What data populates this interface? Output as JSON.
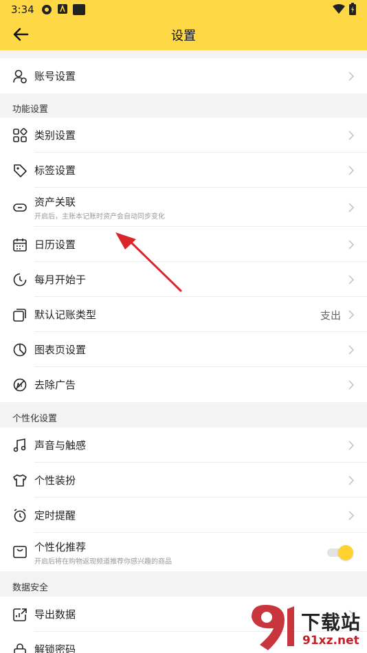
{
  "status": {
    "time": "3:34"
  },
  "header": {
    "title": "设置"
  },
  "account": {
    "label": "账号设置"
  },
  "sections": {
    "func": "功能设置",
    "personal": "个性化设置",
    "data": "数据安全"
  },
  "func_items": [
    {
      "label": "类别设置"
    },
    {
      "label": "标签设置"
    },
    {
      "label": "资产关联",
      "sub": "开启后，主账本记账时资产会自动同步变化"
    },
    {
      "label": "日历设置"
    },
    {
      "label": "每月开始于"
    },
    {
      "label": "默认记账类型",
      "value": "支出"
    },
    {
      "label": "图表页设置"
    },
    {
      "label": "去除广告"
    }
  ],
  "personal_items": [
    {
      "label": "声音与触感"
    },
    {
      "label": "个性装扮"
    },
    {
      "label": "定时提醒"
    },
    {
      "label": "个性化推荐",
      "sub": "开启后将在购物返现频道推荐你感兴趣的商品",
      "toggle_on": true
    }
  ],
  "data_items": [
    {
      "label": "导出数据"
    },
    {
      "label": "解锁密码"
    }
  ],
  "watermark": {
    "brand": "下载站",
    "url": "91xz.net"
  },
  "colors": {
    "accent": "#ffd945",
    "toggle": "#ffd230",
    "arrow": "#d9262c"
  }
}
